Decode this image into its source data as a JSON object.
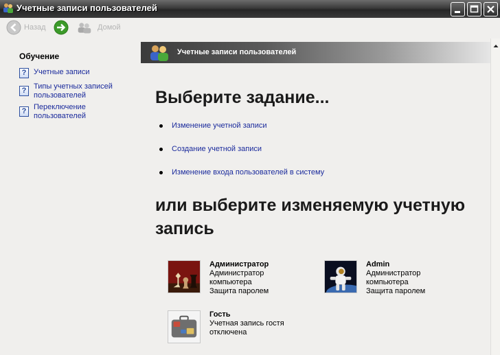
{
  "window": {
    "title": "Учетные записи пользователей"
  },
  "toolbar": {
    "back_label": "Назад",
    "home_label": "Домой"
  },
  "left_panel": {
    "heading": "Обучение",
    "items": [
      {
        "label": "Учетные записи"
      },
      {
        "label": "Типы учетных записей пользователей"
      },
      {
        "label": "Переключение пользователей"
      }
    ]
  },
  "banner": {
    "title": "Учетные записи пользователей"
  },
  "main": {
    "pick_task_heading": "Выберите задание...",
    "tasks": [
      {
        "label": "Изменение учетной записи"
      },
      {
        "label": "Создание учетной записи"
      },
      {
        "label": "Изменение входа пользователей в систему"
      }
    ],
    "pick_account_heading": "или выберите изменяемую учетную запись",
    "accounts": [
      {
        "name": "Администратор",
        "lines": [
          "Администратор",
          "компьютера",
          "Защита паролем"
        ],
        "picture": "chess-pieces"
      },
      {
        "name": "Admin",
        "lines": [
          "Администратор",
          "компьютера",
          "Защита паролем"
        ],
        "picture": "astronaut"
      },
      {
        "name": "Гость",
        "lines": [
          "Учетная запись гостя",
          "отключена"
        ],
        "picture": "suitcase"
      }
    ]
  },
  "colors": {
    "link": "#1a2a9c",
    "titlebar": "#3b3b3b",
    "background": "#f0efed",
    "forward_green": "#3c9a2a"
  }
}
